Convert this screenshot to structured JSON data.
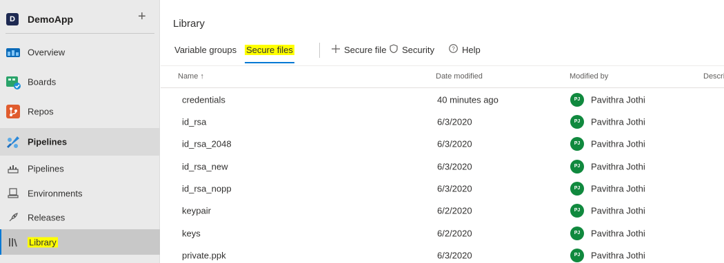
{
  "sidebar": {
    "org_initial": "D",
    "org_name": "DemoApp",
    "add_glyph": "+",
    "items": [
      {
        "label": "Overview",
        "icon": "overview-icon"
      },
      {
        "label": "Boards",
        "icon": "boards-icon"
      },
      {
        "label": "Repos",
        "icon": "repos-icon"
      },
      {
        "label": "Pipelines",
        "icon": "pipelines-section-icon"
      },
      {
        "label": "Pipelines",
        "icon": "pipelines-icon"
      },
      {
        "label": "Environments",
        "icon": "environments-icon"
      },
      {
        "label": "Releases",
        "icon": "releases-icon"
      },
      {
        "label": "Library",
        "icon": "library-icon"
      }
    ]
  },
  "main": {
    "title": "Library",
    "tabs": [
      {
        "label": "Variable groups"
      },
      {
        "label": "Secure files"
      }
    ],
    "commands": [
      {
        "label": "Secure file",
        "icon": "plus-icon"
      },
      {
        "label": "Security",
        "icon": "shield-icon"
      },
      {
        "label": "Help",
        "icon": "help-icon"
      }
    ],
    "columns": {
      "name": "Name",
      "sort_glyph": "↑",
      "date": "Date modified",
      "by": "Modified by",
      "desc": "Descri"
    },
    "rows": [
      {
        "name": "credentials",
        "date": "40 minutes ago",
        "initials": "PJ",
        "user": "Pavithra Jothi"
      },
      {
        "name": "id_rsa",
        "date": "6/3/2020",
        "initials": "PJ",
        "user": "Pavithra Jothi"
      },
      {
        "name": "id_rsa_2048",
        "date": "6/3/2020",
        "initials": "PJ",
        "user": "Pavithra Jothi"
      },
      {
        "name": "id_rsa_new",
        "date": "6/3/2020",
        "initials": "PJ",
        "user": "Pavithra Jothi"
      },
      {
        "name": "id_rsa_nopp",
        "date": "6/3/2020",
        "initials": "PJ",
        "user": "Pavithra Jothi"
      },
      {
        "name": "keypair",
        "date": "6/2/2020",
        "initials": "PJ",
        "user": "Pavithra Jothi"
      },
      {
        "name": "keys",
        "date": "6/2/2020",
        "initials": "PJ",
        "user": "Pavithra Jothi"
      },
      {
        "name": "private.ppk",
        "date": "6/3/2020",
        "initials": "PJ",
        "user": "Pavithra Jothi"
      }
    ]
  },
  "colors": {
    "accent": "#0078d4",
    "highlight": "#ffff00",
    "avatar": "#10893e",
    "sidebar_bg": "#eaeaea"
  }
}
